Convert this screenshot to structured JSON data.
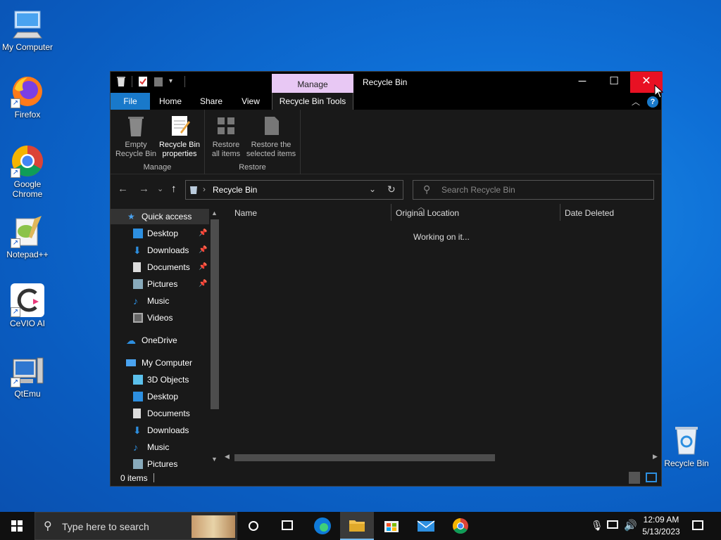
{
  "desktop": {
    "icons": [
      {
        "label": "My Computer"
      },
      {
        "label": "Firefox"
      },
      {
        "label": "Google Chrome"
      },
      {
        "label": "Notepad++"
      },
      {
        "label": "CeVIO AI"
      },
      {
        "label": "QtEmu"
      }
    ],
    "recycle_bin_label": "Recycle Bin"
  },
  "window": {
    "title": "Recycle Bin",
    "manage_tab": "Manage",
    "controls": {
      "minimize": "─",
      "maximize": "☐",
      "close": "✕"
    },
    "tabs": {
      "file": "File",
      "home": "Home",
      "share": "Share",
      "view": "View",
      "tools": "Recycle Bin Tools"
    },
    "help": "?",
    "ribbon": {
      "manage": {
        "label": "Manage",
        "empty": [
          "Empty",
          "Recycle Bin"
        ],
        "properties": [
          "Recycle Bin",
          "properties"
        ]
      },
      "restore": {
        "label": "Restore",
        "all": [
          "Restore",
          "all items"
        ],
        "selected": [
          "Restore the",
          "selected items"
        ]
      }
    },
    "address": {
      "path": "Recycle Bin",
      "sep": "›"
    },
    "search": {
      "placeholder": "Search Recycle Bin"
    },
    "nav": {
      "quick_access": "Quick access",
      "quick": [
        "Desktop",
        "Downloads",
        "Documents",
        "Pictures",
        "Music",
        "Videos"
      ],
      "onedrive": "OneDrive",
      "mycomputer": "My Computer",
      "pc": [
        "3D Objects",
        "Desktop",
        "Documents",
        "Downloads",
        "Music",
        "Pictures"
      ]
    },
    "columns": {
      "name": "Name",
      "location": "Original Location",
      "deleted": "Date Deleted"
    },
    "status_message": "Working on it...",
    "status": {
      "items": "0 items"
    }
  },
  "taskbar": {
    "search_placeholder": "Type here to search",
    "time": "12:09 AM",
    "date": "5/13/2023"
  }
}
